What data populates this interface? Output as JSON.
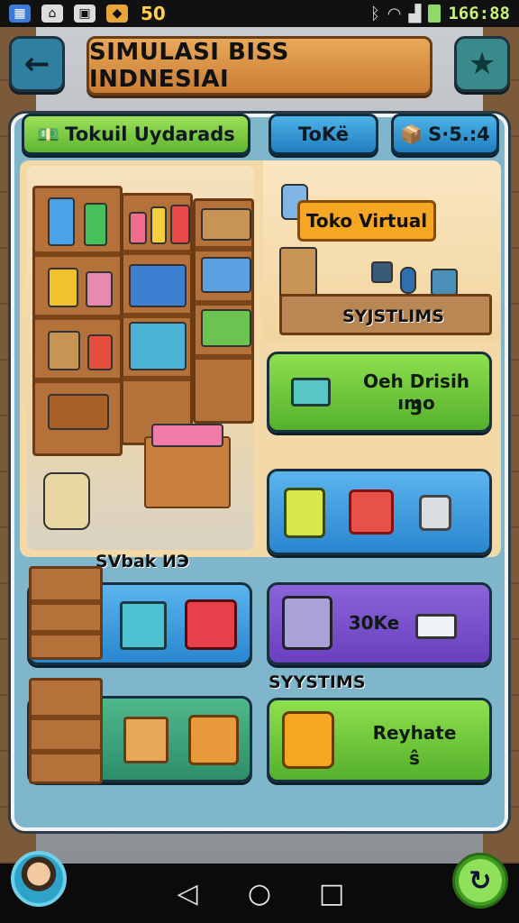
{
  "status_bar": {
    "notif_count": "50",
    "time": "166:88"
  },
  "header": {
    "title": "SIMULASI BISS INDNESIAI",
    "back_icon": "arrow-left-icon",
    "star_icon": "star-icon"
  },
  "tabs": [
    {
      "label": "Tokuil Uydarads",
      "icon": "money-icon"
    },
    {
      "label": "ToKë",
      "icon": ""
    },
    {
      "label": "S·5.:4",
      "icon": "crate-icon"
    }
  ],
  "store": {
    "sign": "Toko Virtual",
    "systems_label_top": "SYJSTLIMS",
    "storage_label": "SVbak ИЭ",
    "systems_label_bottom": "SYYSTIMS"
  },
  "cards": {
    "register_text": "Oeh Drisih ımo",
    "register_sub": "3",
    "purple_text": "30Ke",
    "rebate_text": "Reyhate",
    "rebate_sub": "ŝ"
  },
  "colors": {
    "accent_green": "#5fb531",
    "accent_blue": "#1f7fbf",
    "accent_purple": "#6a3fbf",
    "title_orange": "#c97d34"
  }
}
